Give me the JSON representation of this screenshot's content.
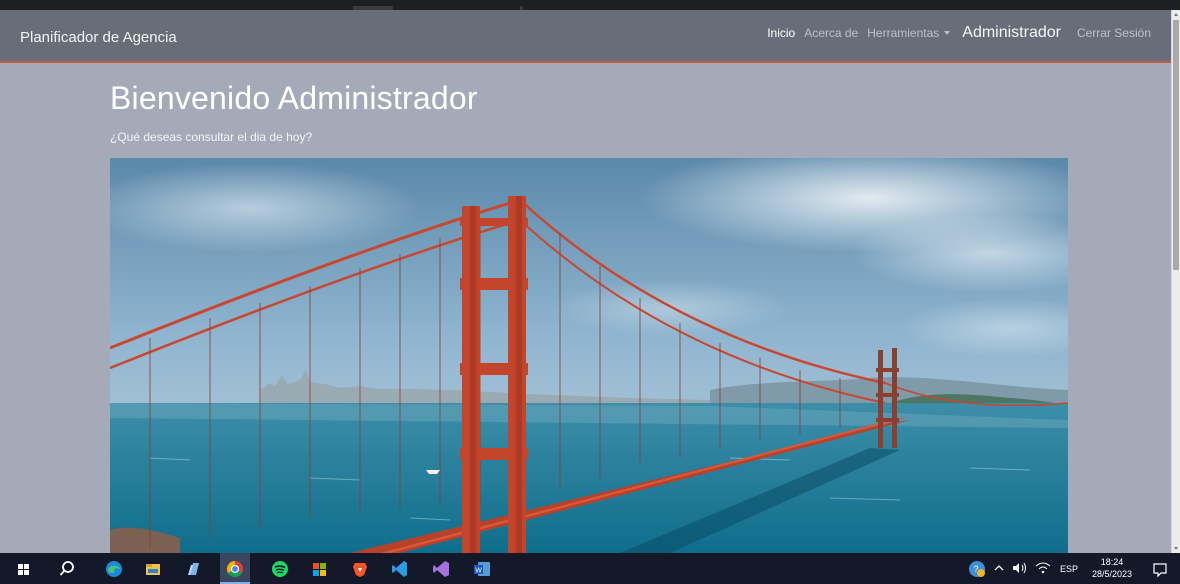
{
  "app": {
    "brand": "Planificador de Agencia"
  },
  "nav": {
    "items": [
      {
        "label": "Inicio"
      },
      {
        "label": "Acerca de"
      },
      {
        "label": "Herramientas"
      },
      {
        "label": "Administrador"
      },
      {
        "label": "Cerrar Sesión"
      }
    ]
  },
  "main": {
    "title": "Bienvenido Administrador",
    "subtitle": "¿Qué deseas consultar el dia de hoy?",
    "hero_image": "golden-gate-bridge-photo"
  },
  "taskbar": {
    "icons": [
      "windows-start-icon",
      "search-icon",
      "edge-browser-icon",
      "file-explorer-icon",
      "notes-app-icon",
      "chrome-icon",
      "spotify-icon",
      "microsoft-store-icon",
      "brave-browser-icon",
      "vscode-icon",
      "visual-studio-icon",
      "word-icon"
    ],
    "language": "ESP",
    "time": "18:24",
    "date": "28/5/2023"
  },
  "colors": {
    "page_bg": "#a4aab8",
    "navbar_bg": "#686e78",
    "navbar_accent": "#c0604c",
    "taskbar_bg": "#14192a"
  }
}
